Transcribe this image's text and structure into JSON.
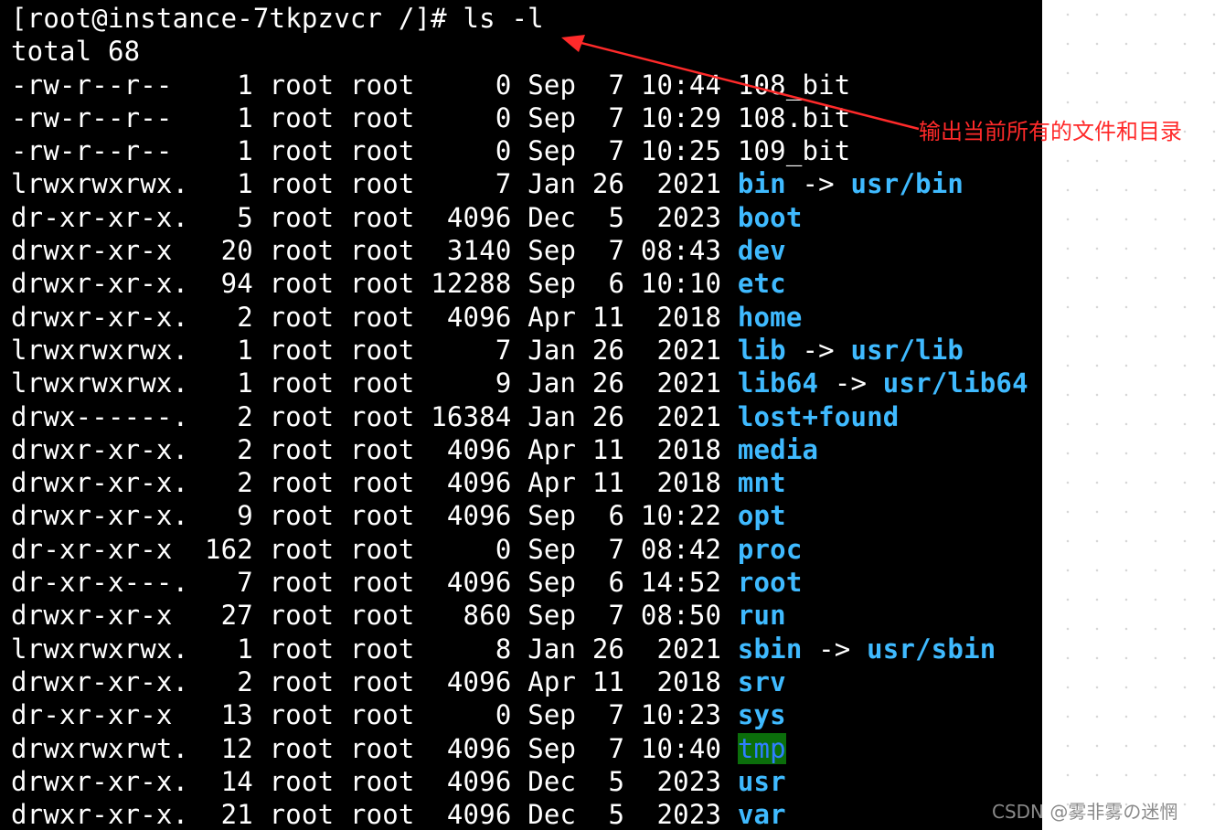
{
  "terminal": {
    "prompt": "[root@instance-7tkpzvcr /]# ",
    "command": "ls -l",
    "total_line": "total 68",
    "entries": [
      {
        "perms": "-rw-r--r--",
        "links": "1",
        "owner": "root",
        "group": "root",
        "size": "0",
        "month": "Sep",
        "day": "7",
        "time": "10:44",
        "name": "108_bit",
        "type": "file",
        "target": ""
      },
      {
        "perms": "-rw-r--r--",
        "links": "1",
        "owner": "root",
        "group": "root",
        "size": "0",
        "month": "Sep",
        "day": "7",
        "time": "10:29",
        "name": "108.bit",
        "type": "file",
        "target": ""
      },
      {
        "perms": "-rw-r--r--",
        "links": "1",
        "owner": "root",
        "group": "root",
        "size": "0",
        "month": "Sep",
        "day": "7",
        "time": "10:25",
        "name": "109_bit",
        "type": "file",
        "target": ""
      },
      {
        "perms": "lrwxrwxrwx.",
        "links": "1",
        "owner": "root",
        "group": "root",
        "size": "7",
        "month": "Jan",
        "day": "26",
        "time": "2021",
        "name": "bin",
        "type": "link",
        "target": "usr/bin"
      },
      {
        "perms": "dr-xr-xr-x.",
        "links": "5",
        "owner": "root",
        "group": "root",
        "size": "4096",
        "month": "Dec",
        "day": "5",
        "time": "2023",
        "name": "boot",
        "type": "dir",
        "target": ""
      },
      {
        "perms": "drwxr-xr-x",
        "links": "20",
        "owner": "root",
        "group": "root",
        "size": "3140",
        "month": "Sep",
        "day": "7",
        "time": "08:43",
        "name": "dev",
        "type": "dir",
        "target": ""
      },
      {
        "perms": "drwxr-xr-x.",
        "links": "94",
        "owner": "root",
        "group": "root",
        "size": "12288",
        "month": "Sep",
        "day": "6",
        "time": "10:10",
        "name": "etc",
        "type": "dir",
        "target": ""
      },
      {
        "perms": "drwxr-xr-x.",
        "links": "2",
        "owner": "root",
        "group": "root",
        "size": "4096",
        "month": "Apr",
        "day": "11",
        "time": "2018",
        "name": "home",
        "type": "dir",
        "target": ""
      },
      {
        "perms": "lrwxrwxrwx.",
        "links": "1",
        "owner": "root",
        "group": "root",
        "size": "7",
        "month": "Jan",
        "day": "26",
        "time": "2021",
        "name": "lib",
        "type": "link",
        "target": "usr/lib"
      },
      {
        "perms": "lrwxrwxrwx.",
        "links": "1",
        "owner": "root",
        "group": "root",
        "size": "9",
        "month": "Jan",
        "day": "26",
        "time": "2021",
        "name": "lib64",
        "type": "link",
        "target": "usr/lib64"
      },
      {
        "perms": "drwx------.",
        "links": "2",
        "owner": "root",
        "group": "root",
        "size": "16384",
        "month": "Jan",
        "day": "26",
        "time": "2021",
        "name": "lost+found",
        "type": "dir",
        "target": ""
      },
      {
        "perms": "drwxr-xr-x.",
        "links": "2",
        "owner": "root",
        "group": "root",
        "size": "4096",
        "month": "Apr",
        "day": "11",
        "time": "2018",
        "name": "media",
        "type": "dir",
        "target": ""
      },
      {
        "perms": "drwxr-xr-x.",
        "links": "2",
        "owner": "root",
        "group": "root",
        "size": "4096",
        "month": "Apr",
        "day": "11",
        "time": "2018",
        "name": "mnt",
        "type": "dir",
        "target": ""
      },
      {
        "perms": "drwxr-xr-x.",
        "links": "9",
        "owner": "root",
        "group": "root",
        "size": "4096",
        "month": "Sep",
        "day": "6",
        "time": "10:22",
        "name": "opt",
        "type": "dir",
        "target": ""
      },
      {
        "perms": "dr-xr-xr-x",
        "links": "162",
        "owner": "root",
        "group": "root",
        "size": "0",
        "month": "Sep",
        "day": "7",
        "time": "08:42",
        "name": "proc",
        "type": "dir",
        "target": ""
      },
      {
        "perms": "dr-xr-x---.",
        "links": "7",
        "owner": "root",
        "group": "root",
        "size": "4096",
        "month": "Sep",
        "day": "6",
        "time": "14:52",
        "name": "root",
        "type": "dir",
        "target": ""
      },
      {
        "perms": "drwxr-xr-x",
        "links": "27",
        "owner": "root",
        "group": "root",
        "size": "860",
        "month": "Sep",
        "day": "7",
        "time": "08:50",
        "name": "run",
        "type": "dir",
        "target": ""
      },
      {
        "perms": "lrwxrwxrwx.",
        "links": "1",
        "owner": "root",
        "group": "root",
        "size": "8",
        "month": "Jan",
        "day": "26",
        "time": "2021",
        "name": "sbin",
        "type": "link",
        "target": "usr/sbin"
      },
      {
        "perms": "drwxr-xr-x.",
        "links": "2",
        "owner": "root",
        "group": "root",
        "size": "4096",
        "month": "Apr",
        "day": "11",
        "time": "2018",
        "name": "srv",
        "type": "dir",
        "target": ""
      },
      {
        "perms": "dr-xr-xr-x",
        "links": "13",
        "owner": "root",
        "group": "root",
        "size": "0",
        "month": "Sep",
        "day": "7",
        "time": "10:23",
        "name": "sys",
        "type": "dir",
        "target": ""
      },
      {
        "perms": "drwxrwxrwt.",
        "links": "12",
        "owner": "root",
        "group": "root",
        "size": "4096",
        "month": "Sep",
        "day": "7",
        "time": "10:40",
        "name": "tmp",
        "type": "sticky",
        "target": ""
      },
      {
        "perms": "drwxr-xr-x.",
        "links": "14",
        "owner": "root",
        "group": "root",
        "size": "4096",
        "month": "Dec",
        "day": "5",
        "time": "2023",
        "name": "usr",
        "type": "dir",
        "target": ""
      },
      {
        "perms": "drwxr-xr-x.",
        "links": "21",
        "owner": "root",
        "group": "root",
        "size": "4096",
        "month": "Dec",
        "day": "5",
        "time": "2023",
        "name": "var",
        "type": "dir",
        "target": ""
      }
    ]
  },
  "annotation": {
    "text": "输出当前所有的文件和目录",
    "color": "#ff2a2a"
  },
  "watermark": {
    "text": "CSDN @雾非雾の迷惘"
  },
  "colors": {
    "terminal_bg": "#000000",
    "text": "#ffffff",
    "dir_and_link": "#3fbaff",
    "sticky_bg": "#0b6e0b",
    "sticky_fg": "#2f7fff"
  }
}
